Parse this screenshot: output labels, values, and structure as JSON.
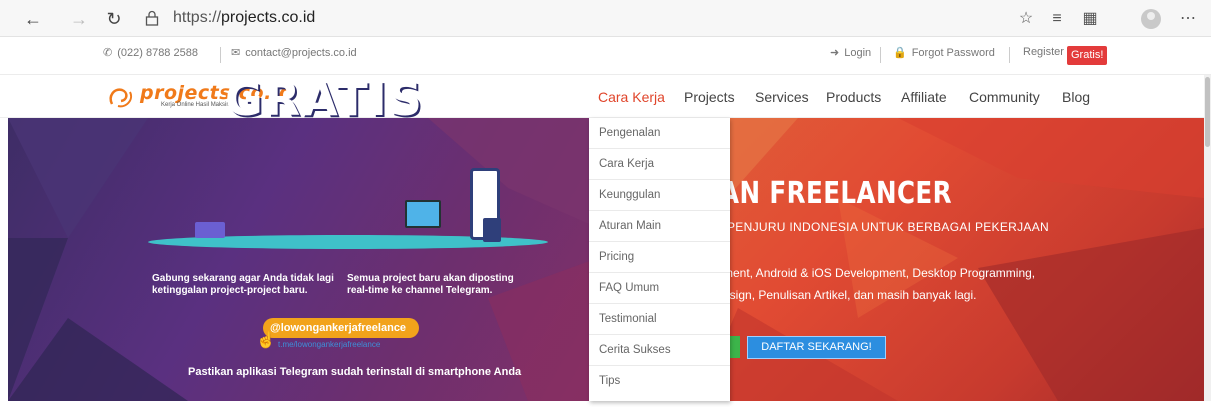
{
  "browser": {
    "url": "https://projects.co.id",
    "url_prefix": "https://",
    "url_host": "projects.co.id"
  },
  "topbar": {
    "phone": "(022) 8788 2588",
    "email": "contact@projects.co.id",
    "login": "Login",
    "forgot": "Forgot Password",
    "register": "Register",
    "gratis": "Gratis!"
  },
  "logo": {
    "name": "projects.co.id",
    "tagline": "Kerja Online Hasil Maksimal"
  },
  "nav": {
    "items": [
      {
        "label": "Cara Kerja",
        "active": true
      },
      {
        "label": "Projects"
      },
      {
        "label": "Services"
      },
      {
        "label": "Products"
      },
      {
        "label": "Affiliate"
      },
      {
        "label": "Community"
      },
      {
        "label": "Blog"
      }
    ]
  },
  "dropdown": {
    "items": [
      "Pengenalan",
      "Cara Kerja",
      "Keunggulan",
      "Aturan Main",
      "Pricing",
      "FAQ Umum",
      "Testimonial",
      "Cerita Sukses",
      "Tips"
    ]
  },
  "hero": {
    "gratis": "GRATIS",
    "left_text_1": "Gabung sekarang agar Anda tidak lagi ketinggalan project-project baru.",
    "left_text_2": "Semua project baru akan diposting real-time ke channel Telegram.",
    "telegram_handle": "@lowongankerjafreelance",
    "telegram_link": "t.me/lowongankerjafreelance",
    "pastikan": "Pastikan aplikasi Telegram sudah terinstall di smartphone Anda",
    "headline": "AN FREELANCER",
    "subhead": "PENJURU INDONESIA UNTUK BERBAGAI PEKERJAAN",
    "desc_1": "ment, Android & iOS Development, Desktop Programming,",
    "desc_2": "esign, Penulisan Artikel, dan masih banyak lagi.",
    "daftar_button": "DAFTAR SEKARANG!"
  },
  "colors": {
    "accent": "#e0452b",
    "gratis_badge": "#e33b3b",
    "logo_orange": "#f07a1a",
    "button_blue": "#2c8ee0"
  }
}
